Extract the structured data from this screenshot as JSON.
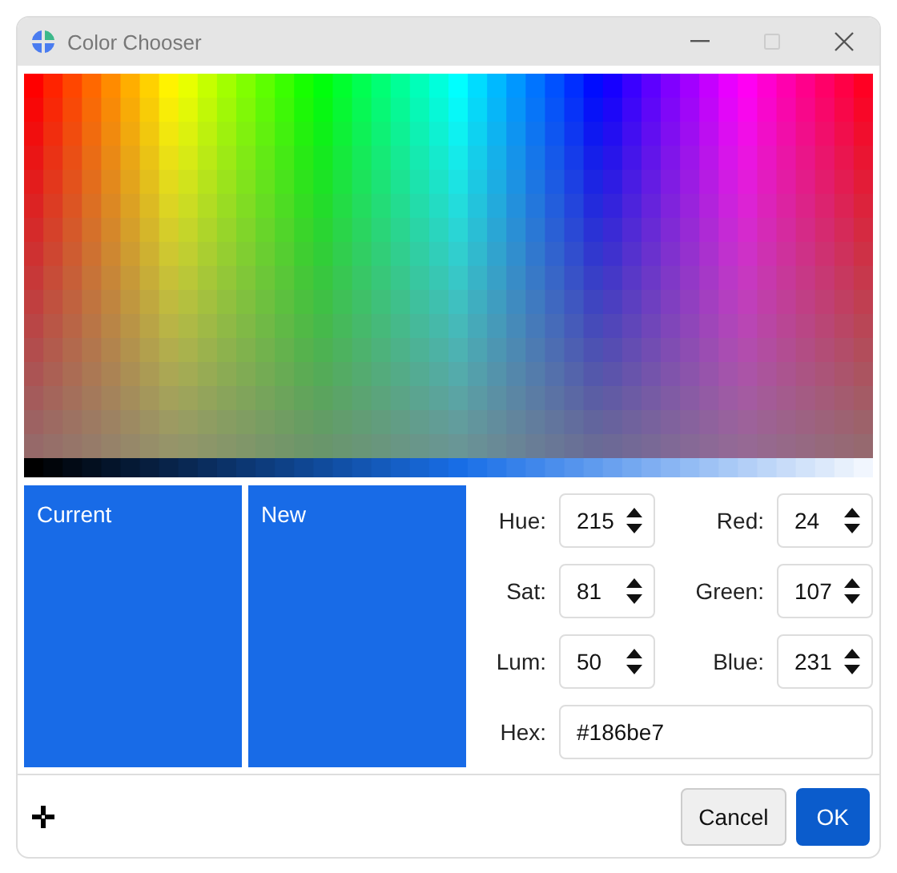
{
  "window": {
    "title": "Color Chooser"
  },
  "swatches": [
    {
      "label": "Current",
      "color": "#186be7"
    },
    {
      "label": "New",
      "color": "#186be7"
    }
  ],
  "fields": [
    {
      "label": "Hue:",
      "value": "215"
    },
    {
      "label": "Red:",
      "value": "24"
    },
    {
      "label": "Sat:",
      "value": "81"
    },
    {
      "label": "Green:",
      "value": "107"
    },
    {
      "label": "Lum:",
      "value": "50"
    },
    {
      "label": "Blue:",
      "value": "231"
    }
  ],
  "hex": {
    "label": "Hex:",
    "value": "#186be7"
  },
  "buttons": [
    {
      "label": "Cancel",
      "kind": "secondary"
    },
    {
      "label": "OK",
      "kind": "primary"
    }
  ]
}
